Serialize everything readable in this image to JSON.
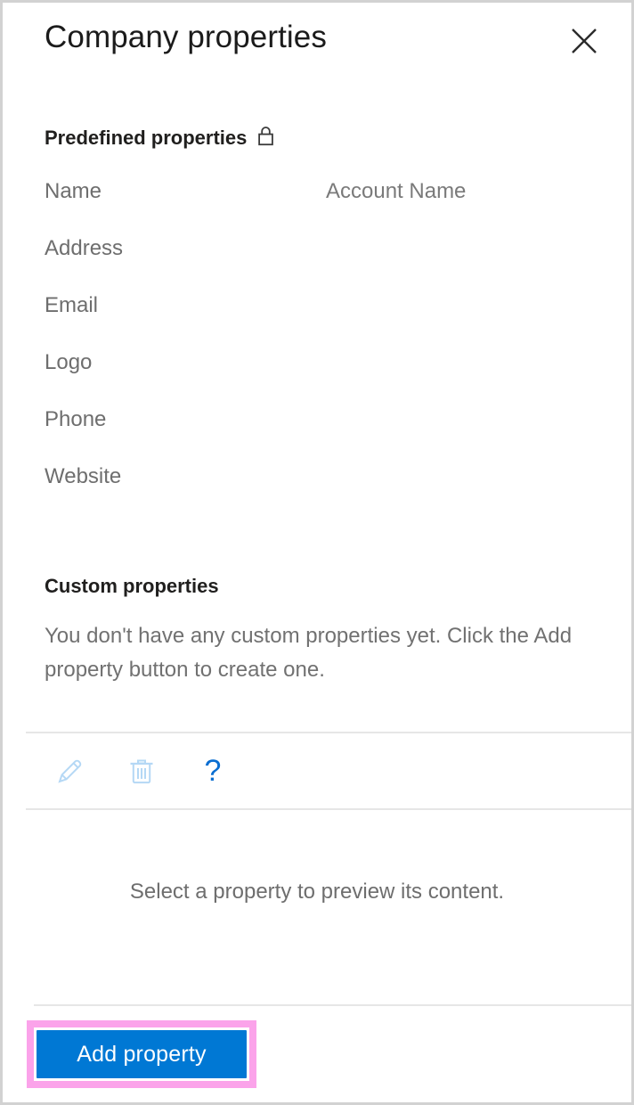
{
  "header": {
    "title": "Company properties",
    "close_icon": "close-icon",
    "close_label": "Close"
  },
  "predefined": {
    "heading": "Predefined properties",
    "lock_icon": "lock-icon",
    "rows": [
      {
        "label": "Name",
        "value": "Account Name"
      },
      {
        "label": "Address",
        "value": ""
      },
      {
        "label": "Email",
        "value": ""
      },
      {
        "label": "Logo",
        "value": ""
      },
      {
        "label": "Phone",
        "value": ""
      },
      {
        "label": "Website",
        "value": ""
      }
    ]
  },
  "custom": {
    "heading": "Custom properties",
    "empty_message": "You don't have any custom properties yet. Click the Add property button to create one."
  },
  "toolbar": {
    "edit_icon": "pencil-icon",
    "edit_label": "Edit",
    "delete_icon": "trash-icon",
    "delete_label": "Delete",
    "help_icon": "question-mark-icon",
    "help_label": "Help",
    "help_glyph": "?"
  },
  "preview": {
    "message": "Select a property to preview its content."
  },
  "footer": {
    "add_button_label": "Add property"
  },
  "colors": {
    "accent_blue": "#0078d4",
    "disabled_icon_blue": "#b5d8f5",
    "help_blue": "#0a6ed1",
    "highlight_pink": "#fba3ea",
    "divider_gray": "#e6e6e6",
    "window_border": "#d2d2d2",
    "body_text_gray": "#6e6e6e",
    "heading_text": "#201f1e"
  }
}
